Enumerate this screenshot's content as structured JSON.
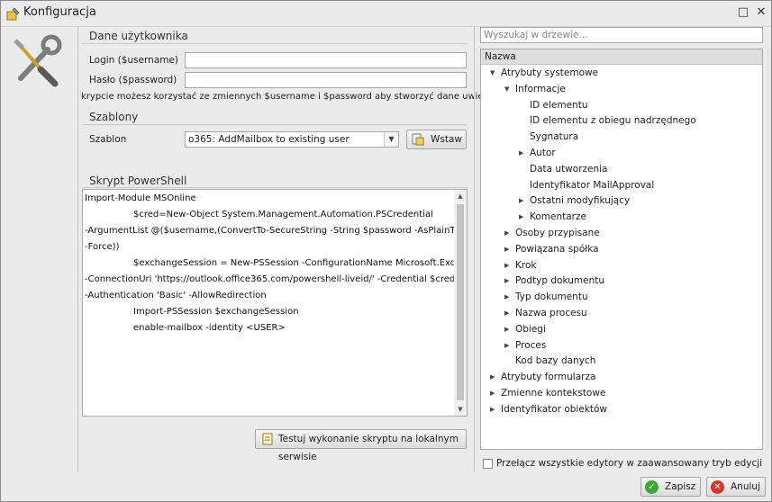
{
  "window": {
    "title": "Konfiguracja",
    "controls": {
      "maximize": "□",
      "close": "✕"
    }
  },
  "user_data": {
    "section_title": "Dane użytkownika",
    "login_label": "Login ($username)",
    "login_value": "",
    "password_label": "Hasło ($password)",
    "password_value": "",
    "hint": "krypcie możesz korzystać ze zmiennych $username i $password aby stworzyć dane uwierzytelniania"
  },
  "templates": {
    "section_title": "Szablony",
    "template_label": "Szablon",
    "selected": "o365: AddMailbox to existing user",
    "insert_label": "Wstaw"
  },
  "script": {
    "section_title": "Skrypt PowerShell",
    "lines": [
      "Import-Module MSOnline",
      "$cred=New-Object System.Management.Automation.PSCredential",
      "-ArgumentList @($username,(ConvertTo-SecureString -String $password -AsPlainText",
      "-Force))",
      "$exchangeSession = New-PSSession -ConfigurationName Microsoft.Exchange",
      "-ConnectionUri 'https://outlook.office365.com/powershell-liveid/' -Credential $cred",
      "-Authentication 'Basic' -AllowRedirection",
      "Import-PSSession $exchangeSession",
      "enable-mailbox -identity <USER>"
    ],
    "test_label": "Testuj wykonanie skryptu na lokalnym serwisie"
  },
  "tree": {
    "search_placeholder": "Wyszukaj w drzewie...",
    "column_header": "Nazwa",
    "nodes": [
      {
        "label": "Atrybuty systemowe",
        "level": 0,
        "state": "expanded"
      },
      {
        "label": "Informacje",
        "level": 1,
        "state": "expanded"
      },
      {
        "label": "ID elementu",
        "level": 2,
        "state": "leaf"
      },
      {
        "label": "ID elementu z obiegu nadrzędnego",
        "level": 2,
        "state": "leaf"
      },
      {
        "label": "Sygnatura",
        "level": 2,
        "state": "leaf"
      },
      {
        "label": "Autor",
        "level": 2,
        "state": "collapsed"
      },
      {
        "label": "Data utworzenia",
        "level": 2,
        "state": "leaf"
      },
      {
        "label": "Identyfikator MailApproval",
        "level": 2,
        "state": "leaf"
      },
      {
        "label": "Ostatni modyfikujący",
        "level": 2,
        "state": "collapsed"
      },
      {
        "label": "Komentarze",
        "level": 2,
        "state": "collapsed"
      },
      {
        "label": "Osoby przypisane",
        "level": 1,
        "state": "collapsed"
      },
      {
        "label": "Powiązana spółka",
        "level": 1,
        "state": "collapsed"
      },
      {
        "label": "Krok",
        "level": 1,
        "state": "collapsed"
      },
      {
        "label": "Podtyp dokumentu",
        "level": 1,
        "state": "collapsed"
      },
      {
        "label": "Typ dokumentu",
        "level": 1,
        "state": "collapsed"
      },
      {
        "label": "Nazwa procesu",
        "level": 1,
        "state": "collapsed"
      },
      {
        "label": "Obiegi",
        "level": 1,
        "state": "collapsed"
      },
      {
        "label": "Proces",
        "level": 1,
        "state": "collapsed"
      },
      {
        "label": "Kod bazy danych",
        "level": 1,
        "state": "leaf"
      },
      {
        "label": "Atrybuty formularza",
        "level": 0,
        "state": "collapsed"
      },
      {
        "label": "Zmienne kontekstowe",
        "level": 0,
        "state": "collapsed"
      },
      {
        "label": "Identyfikator obiektów",
        "level": 0,
        "state": "collapsed"
      }
    ],
    "advanced_mode_label": "Przełącz wszystkie edytory w zaawansowany tryb edycji",
    "advanced_mode_checked": false
  },
  "footer": {
    "save_label": "Zapisz",
    "cancel_label": "Anuluj"
  },
  "colors": {
    "save_icon": "#3aa935",
    "cancel_icon": "#d9342b",
    "accent": "#c9a227"
  }
}
